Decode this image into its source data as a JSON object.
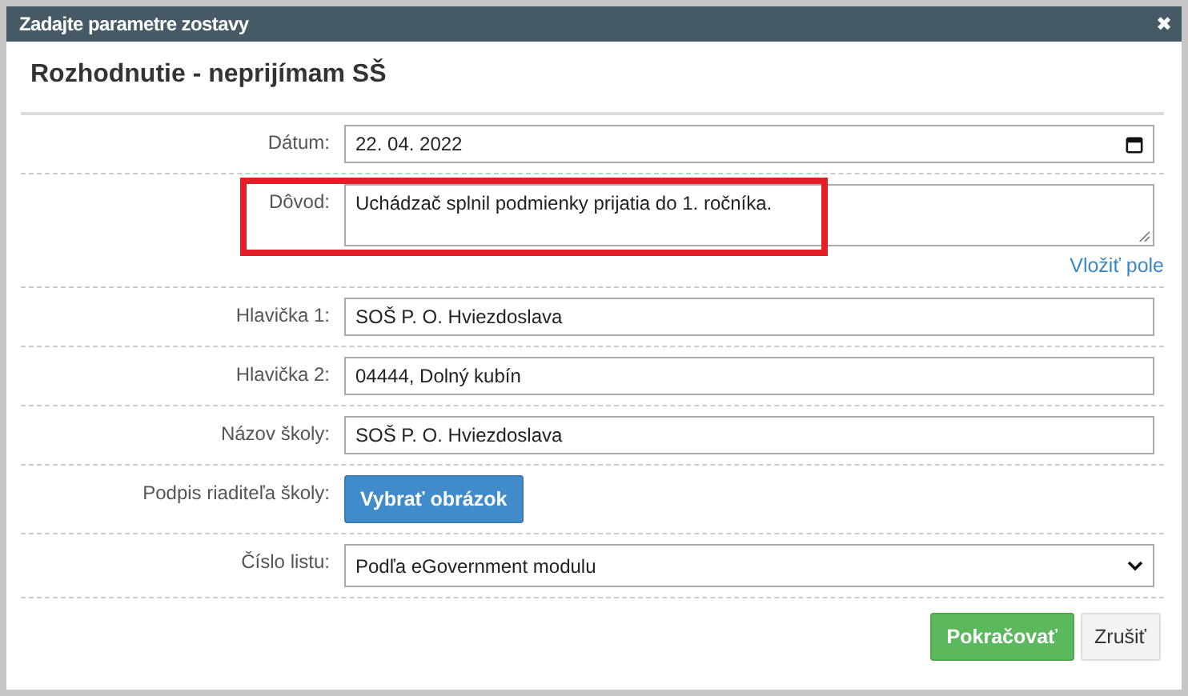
{
  "window": {
    "title": "Zadajte parametre zostavy",
    "close": "✖"
  },
  "heading": "Rozhodnutie - neprijímam SŠ",
  "rows": [
    {
      "kind": "date",
      "label": "Dátum:",
      "value": "22. 04. 2022",
      "highlighted": false
    },
    {
      "kind": "textarea",
      "label": "Dôvod:",
      "value": "Uchádzač splnil podmienky prijatia do 1. ročníka.",
      "link": "Vložiť pole",
      "highlighted": true
    },
    {
      "kind": "text",
      "label": "Hlavička 1:",
      "value": "SOŠ P. O. Hviezdoslava",
      "highlighted": false
    },
    {
      "kind": "text",
      "label": "Hlavička 2:",
      "value": "04444, Dolný kubín",
      "highlighted": false
    },
    {
      "kind": "text",
      "label": "Názov školy:",
      "value": "SOŠ P. O. Hviezdoslava",
      "highlighted": false
    },
    {
      "kind": "button",
      "label": "Podpis riaditeľa školy:",
      "value": "Vybrať obrázok",
      "highlighted": false
    },
    {
      "kind": "select",
      "label": "Číslo listu:",
      "value": "Podľa eGovernment modulu",
      "highlighted": false
    }
  ],
  "buttons": [
    {
      "kind": "primary",
      "label": "Pokračovať"
    },
    {
      "kind": "default",
      "label": "Zrušiť"
    }
  ]
}
